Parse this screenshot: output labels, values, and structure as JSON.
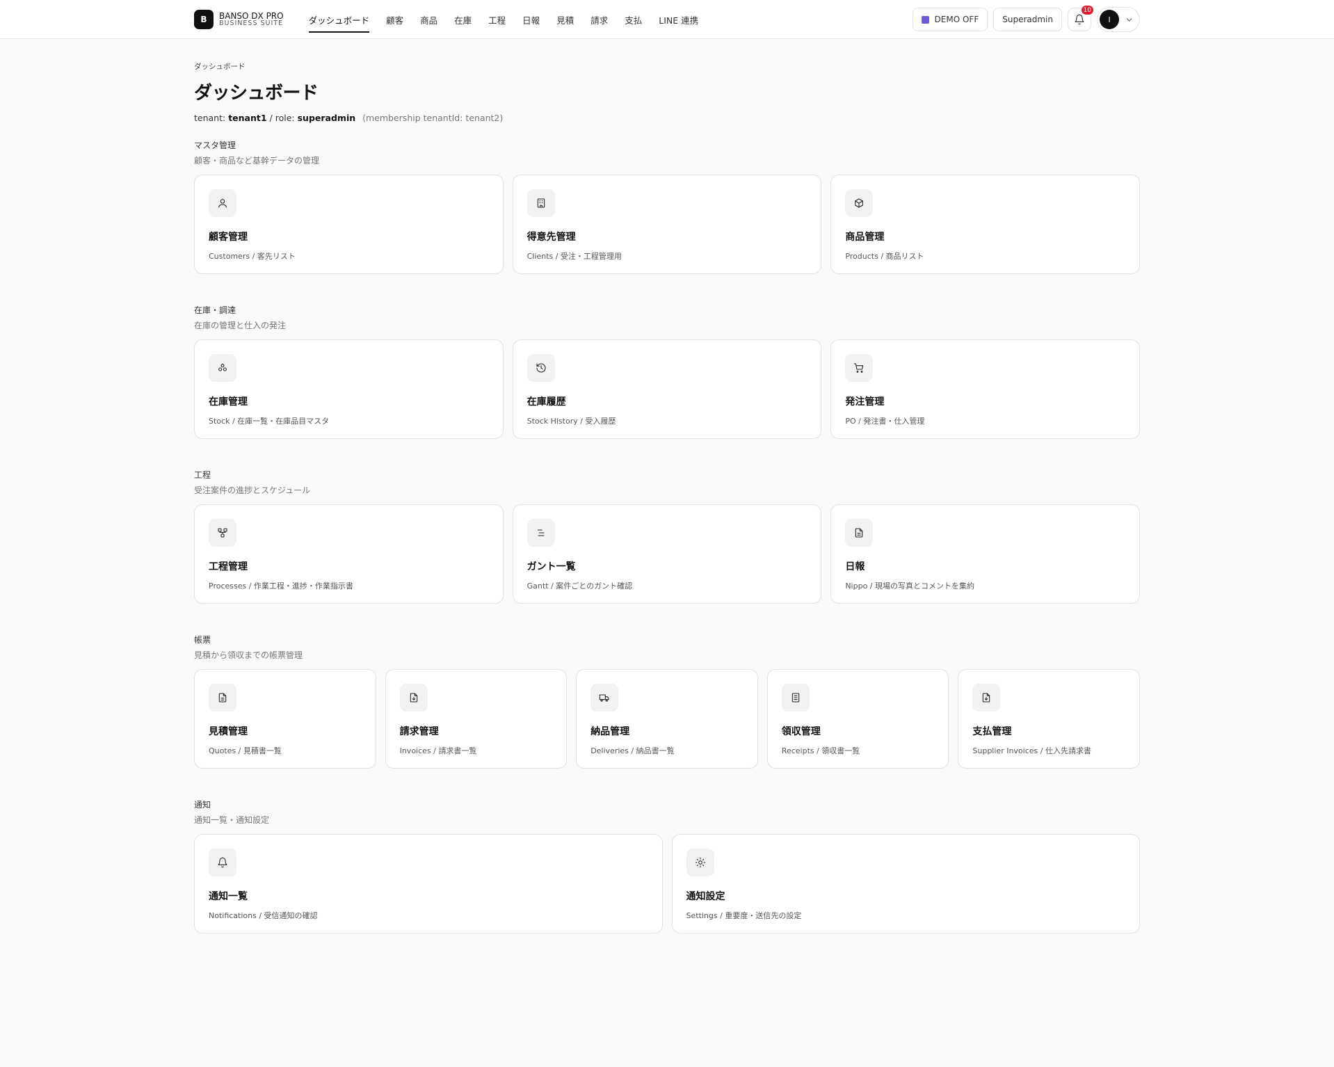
{
  "header": {
    "logo_letter": "B",
    "brand_name": "BANSO DX PRO",
    "brand_sub": "BUSINESS SUITE",
    "nav": [
      "ダッシュボード",
      "顧客",
      "商品",
      "在庫",
      "工程",
      "日報",
      "見積",
      "請求",
      "支払",
      "LINE 連携"
    ],
    "demo_label": "DEMO OFF",
    "role_label": "Superadmin",
    "notification_count": "10",
    "avatar_letter": "I"
  },
  "page": {
    "breadcrumb": "ダッシュボード",
    "title": "ダッシュボード",
    "tenant_label": "tenant:",
    "tenant_value": "tenant1",
    "role_label": "/ role:",
    "role_value": "superadmin",
    "membership_note": "(membership tenantId: tenant2)"
  },
  "sections": {
    "master": {
      "title": "マスタ管理",
      "subtitle": "顧客・商品など基幹データの管理",
      "cards": [
        {
          "title": "顧客管理",
          "sub": "Customers / 客先リスト",
          "icon": "user-icon"
        },
        {
          "title": "得意先管理",
          "sub": "Clients / 受注・工程管理用",
          "icon": "building-icon"
        },
        {
          "title": "商品管理",
          "sub": "Products / 商品リスト",
          "icon": "box-icon"
        }
      ]
    },
    "stock": {
      "title": "在庫・調達",
      "subtitle": "在庫の管理と仕入の発注",
      "cards": [
        {
          "title": "在庫管理",
          "sub": "Stock / 在庫一覧・在庫品目マスタ",
          "icon": "boxes-icon"
        },
        {
          "title": "在庫履歴",
          "sub": "Stock History / 受入履歴",
          "icon": "history-icon"
        },
        {
          "title": "発注管理",
          "sub": "PO / 発注書・仕入管理",
          "icon": "cart-icon"
        }
      ]
    },
    "process": {
      "title": "工程",
      "subtitle": "受注案件の進捗とスケジュール",
      "cards": [
        {
          "title": "工程管理",
          "sub": "Processes / 作業工程・進捗・作業指示書",
          "icon": "workflow-icon"
        },
        {
          "title": "ガント一覧",
          "sub": "Gantt / 案件ごとのガント確認",
          "icon": "gantt-icon"
        },
        {
          "title": "日報",
          "sub": "Nippo / 現場の写真とコメントを集約",
          "icon": "file-text-icon"
        }
      ]
    },
    "docs": {
      "title": "帳票",
      "subtitle": "見積から領収までの帳票管理",
      "cards": [
        {
          "title": "見積管理",
          "sub": "Quotes / 見積書一覧",
          "icon": "file-lines-icon"
        },
        {
          "title": "請求管理",
          "sub": "Invoices / 請求書一覧",
          "icon": "file-download-icon"
        },
        {
          "title": "納品管理",
          "sub": "Deliveries / 納品書一覧",
          "icon": "truck-icon"
        },
        {
          "title": "領収管理",
          "sub": "Receipts / 領収書一覧",
          "icon": "receipt-icon"
        },
        {
          "title": "支払管理",
          "sub": "Supplier Invoices / 仕入先請求書",
          "icon": "file-download-icon"
        }
      ]
    },
    "notify": {
      "title": "通知",
      "subtitle": "通知一覧・通知設定",
      "cards": [
        {
          "title": "通知一覧",
          "sub": "Notifications / 受信通知の確認",
          "icon": "bell-icon"
        },
        {
          "title": "通知設定",
          "sub": "Settings / 重要度・送信先の設定",
          "icon": "sun-settings-icon"
        }
      ]
    }
  },
  "colors": {
    "accent": "#111111",
    "badge": "#e11d2e",
    "demo_icon": "#6b5bd6",
    "background": "#fafafa"
  }
}
